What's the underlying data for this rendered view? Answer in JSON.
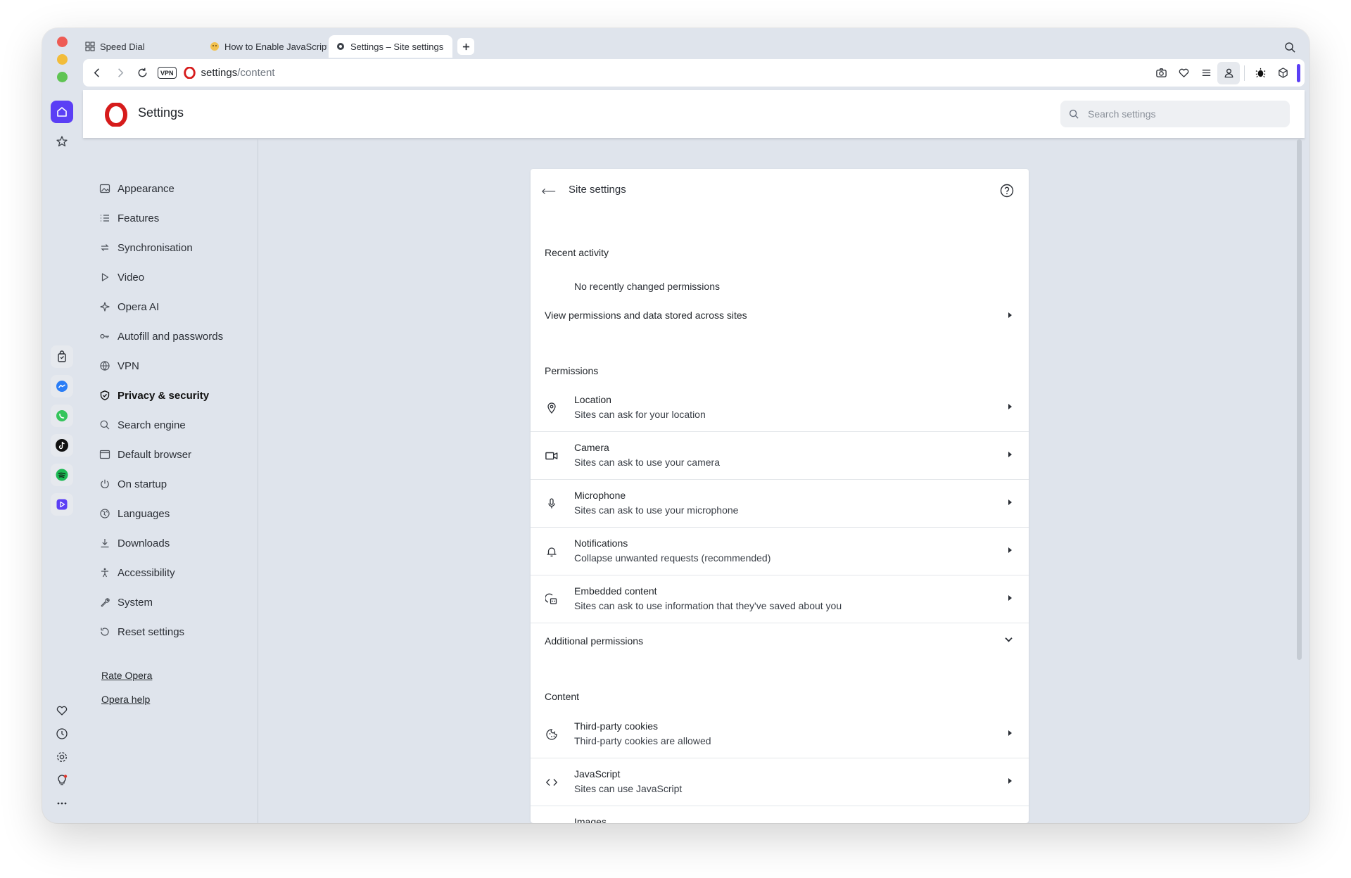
{
  "tabs": [
    {
      "label": "Speed Dial",
      "icon": "grid-icon"
    },
    {
      "label": "How to Enable JavaScript",
      "icon": "favicon-icon"
    },
    {
      "label": "Settings – Site settings",
      "icon": "gear-icon"
    }
  ],
  "toolbar": {
    "vpn_label": "VPN",
    "url_host": "settings",
    "url_path": "/content"
  },
  "header": {
    "title": "Settings",
    "search_placeholder": "Search settings"
  },
  "nav": {
    "items": [
      {
        "label": "Appearance",
        "icon": "image-icon"
      },
      {
        "label": "Features",
        "icon": "list-icon"
      },
      {
        "label": "Synchronisation",
        "icon": "sync-icon"
      },
      {
        "label": "Video",
        "icon": "play-icon"
      },
      {
        "label": "Opera AI",
        "icon": "sparkle-icon"
      },
      {
        "label": "Autofill and passwords",
        "icon": "key-icon"
      },
      {
        "label": "VPN",
        "icon": "globe-icon"
      },
      {
        "label": "Privacy & security",
        "icon": "shield-icon"
      },
      {
        "label": "Search engine",
        "icon": "search-icon"
      },
      {
        "label": "Default browser",
        "icon": "browser-icon"
      },
      {
        "label": "On startup",
        "icon": "power-icon"
      },
      {
        "label": "Languages",
        "icon": "language-icon"
      },
      {
        "label": "Downloads",
        "icon": "download-icon"
      },
      {
        "label": "Accessibility",
        "icon": "accessibility-icon"
      },
      {
        "label": "System",
        "icon": "wrench-icon"
      },
      {
        "label": "Reset settings",
        "icon": "reset-icon"
      }
    ],
    "links": [
      "Rate Opera",
      "Opera help"
    ]
  },
  "card": {
    "title": "Site settings",
    "recent_activity": {
      "heading": "Recent activity",
      "empty": "No recently changed permissions"
    },
    "view_permissions": "View permissions and data stored across sites",
    "permissions": {
      "heading": "Permissions",
      "items": [
        {
          "title": "Location",
          "sub": "Sites can ask for your location",
          "icon": "location-pin-icon"
        },
        {
          "title": "Camera",
          "sub": "Sites can ask to use your camera",
          "icon": "camera-icon"
        },
        {
          "title": "Microphone",
          "sub": "Sites can ask to use your microphone",
          "icon": "microphone-icon"
        },
        {
          "title": "Notifications",
          "sub": "Collapse unwanted requests (recommended)",
          "icon": "bell-icon"
        },
        {
          "title": "Embedded content",
          "sub": "Sites can ask to use information that they've saved about you",
          "icon": "embedded-content-icon"
        }
      ]
    },
    "additional_permissions": "Additional permissions",
    "content": {
      "heading": "Content",
      "items": [
        {
          "title": "Third-party cookies",
          "sub": "Third-party cookies are allowed",
          "icon": "cookie-icon"
        },
        {
          "title": "JavaScript",
          "sub": "Sites can use JavaScript",
          "icon": "code-icon"
        },
        {
          "title": "Images",
          "sub": "",
          "icon": "image-icon"
        }
      ]
    }
  },
  "colors": {
    "accent": "#5b3ff5",
    "opera_red": "#d61b1b",
    "traffic_red": "#ee5b54",
    "traffic_yellow": "#f2bc3a",
    "traffic_green": "#5fc453"
  }
}
